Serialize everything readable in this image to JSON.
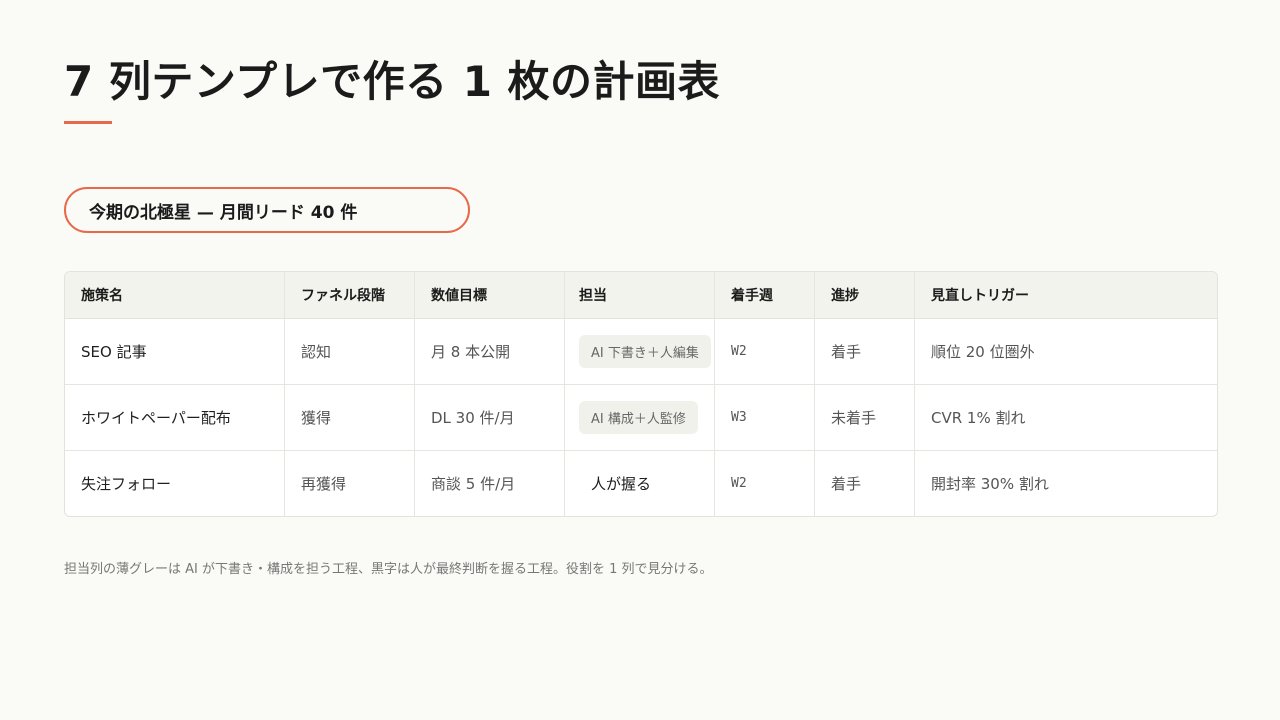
{
  "slide": {
    "title": "7 列テンプレで作る 1 枚の計画表",
    "north_star": "今期の北極星 — 月間リード 40 件",
    "footnote": "担当列の薄グレーは AI が下書き・構成を担う工程、黒字は人が最終判断を握る工程。役割を 1 列で見分ける。",
    "accent_color": "#e8694a"
  },
  "table": {
    "headers": [
      "施策名",
      "ファネル段階",
      "数値目標",
      "担当",
      "着手週",
      "進捗",
      "見直しトリガー"
    ],
    "rows": [
      {
        "name": "SEO 記事",
        "stage": "認知",
        "target": "月 8 本公開",
        "owner": "AI 下書き＋人編集",
        "owner_type": "ai",
        "week": "W2",
        "status": "着手",
        "trigger": "順位 20 位圏外"
      },
      {
        "name": "ホワイトペーパー配布",
        "stage": "獲得",
        "target": "DL 30 件/月",
        "owner": "AI 構成＋人監修",
        "owner_type": "ai",
        "week": "W3",
        "status": "未着手",
        "trigger": "CVR 1% 割れ"
      },
      {
        "name": "失注フォロー",
        "stage": "再獲得",
        "target": "商談 5 件/月",
        "owner": "人が握る",
        "owner_type": "human",
        "week": "W2",
        "status": "着手",
        "trigger": "開封率 30% 割れ"
      }
    ]
  }
}
